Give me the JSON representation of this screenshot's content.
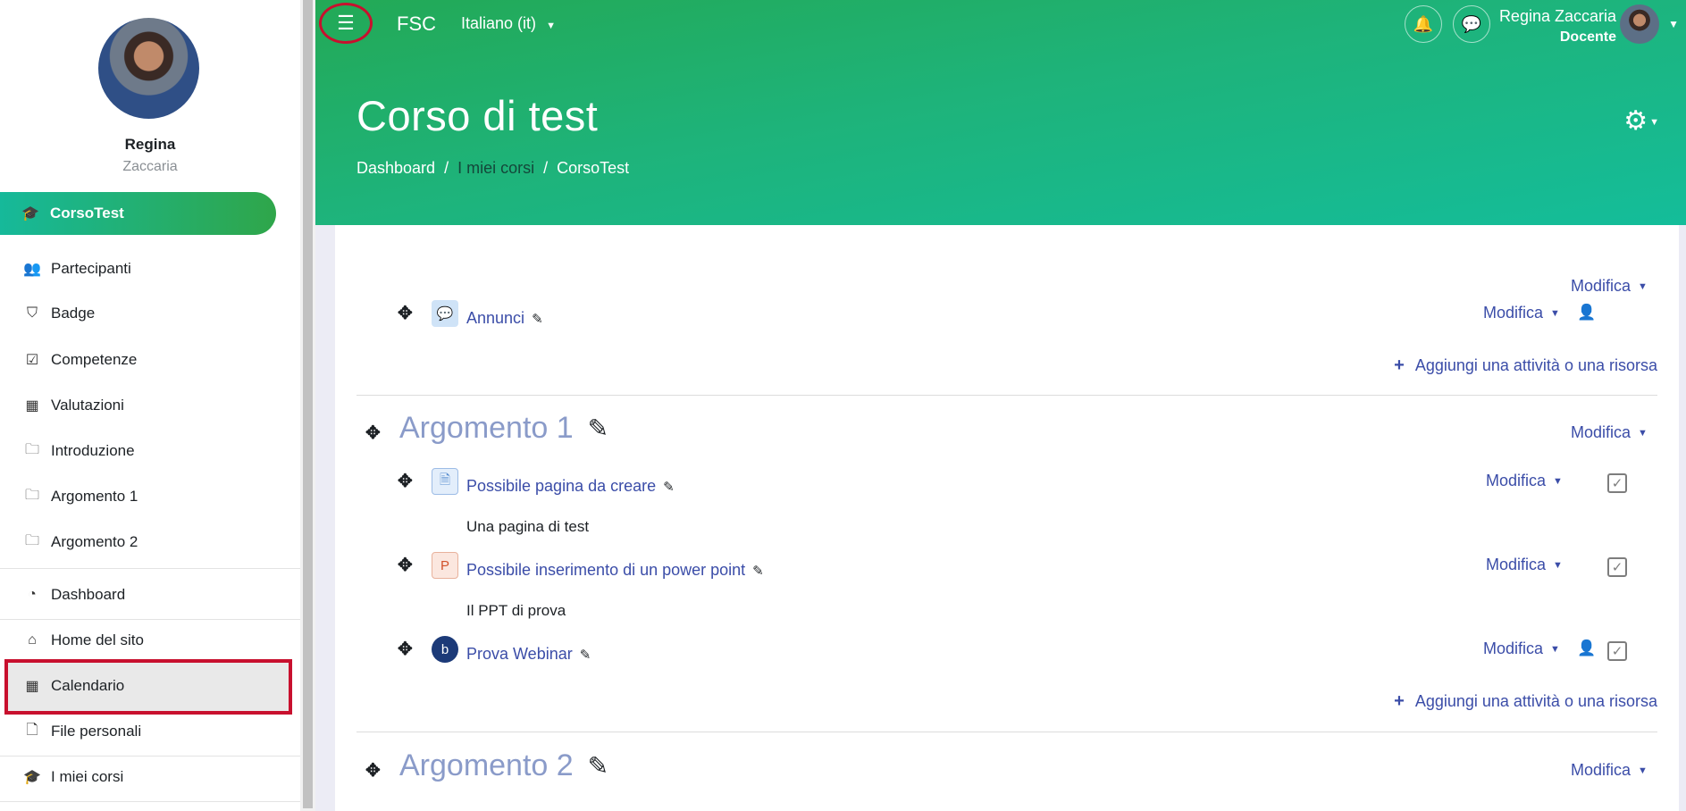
{
  "sidebar": {
    "user_first": "Regina",
    "user_last": "Zaccaria",
    "course": "CorsoTest",
    "items": [
      {
        "label": "Partecipanti",
        "icon": "users-icon",
        "glyph": "👥"
      },
      {
        "label": "Badge",
        "icon": "shield-icon",
        "glyph": "⛉"
      },
      {
        "label": "Competenze",
        "icon": "check-square-icon",
        "glyph": "☑"
      },
      {
        "label": "Valutazioni",
        "icon": "table-icon",
        "glyph": "▦"
      },
      {
        "label": "Introduzione",
        "icon": "folder-icon",
        "glyph": "🗀"
      },
      {
        "label": "Argomento 1",
        "icon": "folder-icon",
        "glyph": "🗀"
      },
      {
        "label": "Argomento 2",
        "icon": "folder-icon",
        "glyph": "🗀"
      }
    ],
    "items2": [
      {
        "label": "Dashboard",
        "icon": "tachometer-icon",
        "glyph": "◔"
      },
      {
        "label": "Home del sito",
        "icon": "home-icon",
        "glyph": "⌂"
      },
      {
        "label": "Calendario",
        "icon": "calendar-icon",
        "glyph": "▦"
      },
      {
        "label": "File personali",
        "icon": "file-icon",
        "glyph": "🗋"
      },
      {
        "label": "I miei corsi",
        "icon": "graduation-cap-icon",
        "glyph": "🎓"
      }
    ]
  },
  "navbar": {
    "brand": "FSC",
    "language": "Italiano (it)",
    "user_name": "Regina Zaccaria",
    "user_role": "Docente"
  },
  "header": {
    "title": "Corso di test",
    "breadcrumb": [
      "Dashboard",
      "I miei corsi",
      "CorsoTest"
    ],
    "separator": "/"
  },
  "content": {
    "edit_label": "Modifica",
    "add_label": "Aggiungi una attività o una risorsa",
    "general": {
      "activity": "Annunci"
    },
    "section1": {
      "title": "Argomento 1",
      "activities": [
        {
          "name": "Possibile pagina da creare",
          "desc": "Una pagina di test"
        },
        {
          "name": "Possibile inserimento di un power point",
          "desc": "Il PPT di prova"
        },
        {
          "name": "Prova Webinar",
          "desc": ""
        }
      ]
    },
    "section2": {
      "title": "Argomento 2"
    }
  }
}
